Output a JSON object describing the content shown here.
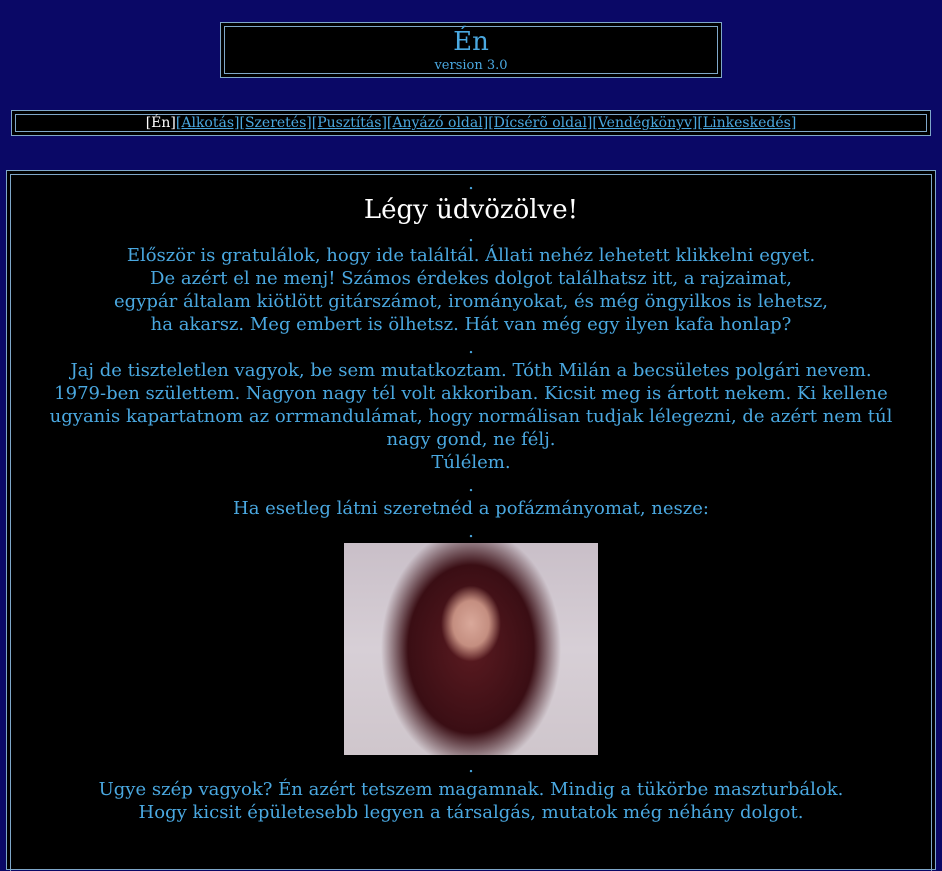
{
  "header": {
    "title": "Én",
    "version": "version 3.0"
  },
  "nav": {
    "current": "[Én]",
    "links": [
      "[Alkotás]",
      "[Szeretés]",
      "[Pusztítás]",
      "[Anyázó oldal]",
      "[Dícsérõ oldal]",
      "[Vendégkönyv]",
      "[Linkeskedés]"
    ]
  },
  "content": {
    "dot": ".",
    "welcome": "Légy üdvözölve!",
    "p1": [
      "Először is gratulálok, hogy ide találtál. Állati nehéz lehetett klikkelni egyet.",
      "De azért el ne menj! Számos érdekes dolgot találhatsz itt, a rajzaimat,",
      "egypár általam kiötlött gitárszámot, irományokat, és még öngyilkos is lehetsz,",
      "ha akarsz. Meg embert is ölhetsz. Hát van  még egy ilyen kafa honlap?"
    ],
    "p2": [
      "Jaj de tiszteletlen vagyok, be sem mutatkoztam. Tóth Milán a becsületes polgári nevem.",
      "1979-ben születtem. Nagyon nagy tél volt akkoriban. Kicsit meg is ártott nekem. Ki kellene",
      "ugyanis kapartatnom az orrmandulámat, hogy normálisan tudjak lélegezni, de azért nem túl",
      "nagy gond, ne félj.",
      "Túlélem."
    ],
    "p3": "Ha esetleg látni szeretnéd a pofázmányomat, nesze:",
    "p4": [
      "Ugye szép vagyok? Én azért tetszem magamnak. Mindig a tükörbe maszturbálok.",
      "Hogy kicsit épületesebb legyen a társalgás, mutatok még néhány dolgot."
    ]
  },
  "colors": {
    "background": "#0a0866",
    "link": "#4aa8e0",
    "panel": "#000000",
    "border": "#7fa7c9"
  }
}
